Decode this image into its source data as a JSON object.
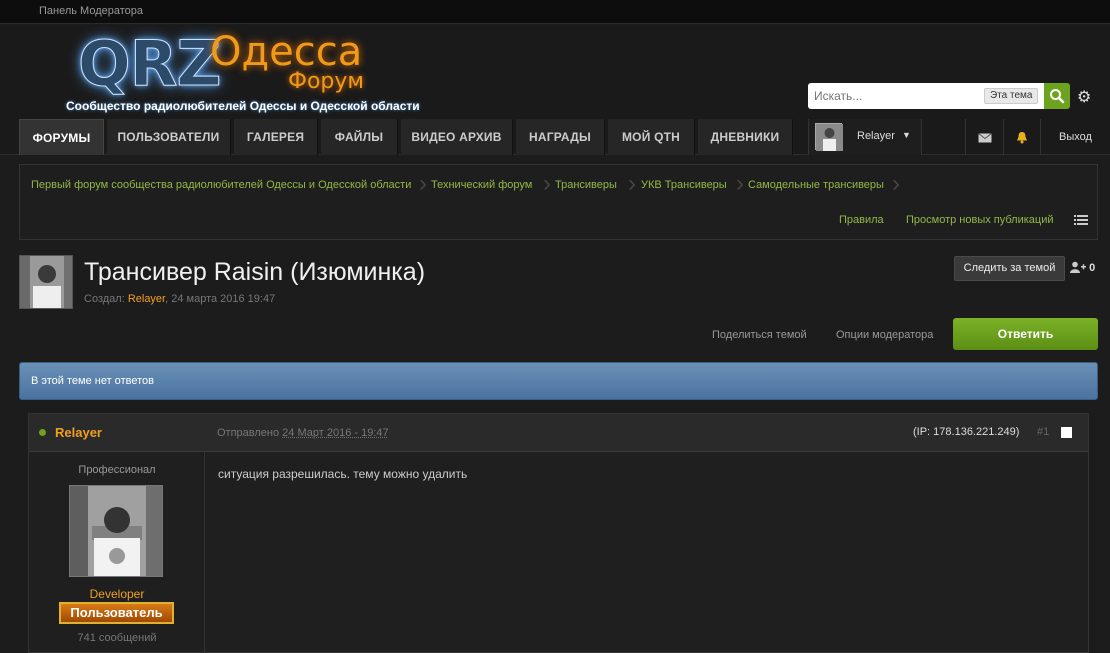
{
  "topbar": {
    "mod_panel": "Панель Модератора"
  },
  "logo": {
    "brand": "QRZ",
    "city": "Одесса",
    "forum_word": "Форум",
    "slogan": "Сообщество радиолюбителей Одессы и Одесской области"
  },
  "search": {
    "placeholder": "Искать...",
    "scope": "Эта тема"
  },
  "nav": {
    "tabs": [
      "ФОРУМЫ",
      "ПОЛЬЗОВАТЕЛИ",
      "ГАЛЕРЕЯ",
      "ФАЙЛЫ",
      "ВИДЕО АРХИВ",
      "НАГРАДЫ",
      "МОЙ QTH",
      "ДНЕВНИКИ"
    ],
    "user": "Relayer",
    "logout": "Выход"
  },
  "breadcrumb": {
    "items": [
      "Первый форум сообщества радиолюбителей Одессы и Одесской области",
      "Технический форум",
      "Трансиверы",
      "УКВ Трансиверы",
      "Самодельные трансиверы"
    ],
    "rules": "Правила",
    "new_posts": "Просмотр новых публикаций"
  },
  "topic": {
    "title": "Трансивер Raisin (Изюминка)",
    "created_label": "Создал: ",
    "author": "Relayer",
    "date": ", 24 марта 2016 19:47",
    "follow": "Следить за темой",
    "followers": "0",
    "share": "Поделиться темой",
    "mod_options": "Опции модератора",
    "reply": "Ответить"
  },
  "info": {
    "no_replies": "В этой теме нет ответов"
  },
  "post": {
    "author": "Relayer",
    "sent_label": "Отправлено ",
    "date": "24 Март 2016 - 19:47",
    "ip": "(IP: 178.136.221.249)",
    "number": "#1",
    "rank": "Профессионал",
    "role": "Developer",
    "group": "Пользователь",
    "post_count": "741 сообщений",
    "body": "ситуация разрешилась. тему можно удалить"
  },
  "colors": {
    "accent_green": "#6ea320",
    "link_green": "#93b848",
    "author_orange": "#f0a020",
    "info_blue": "#4a73a0"
  }
}
